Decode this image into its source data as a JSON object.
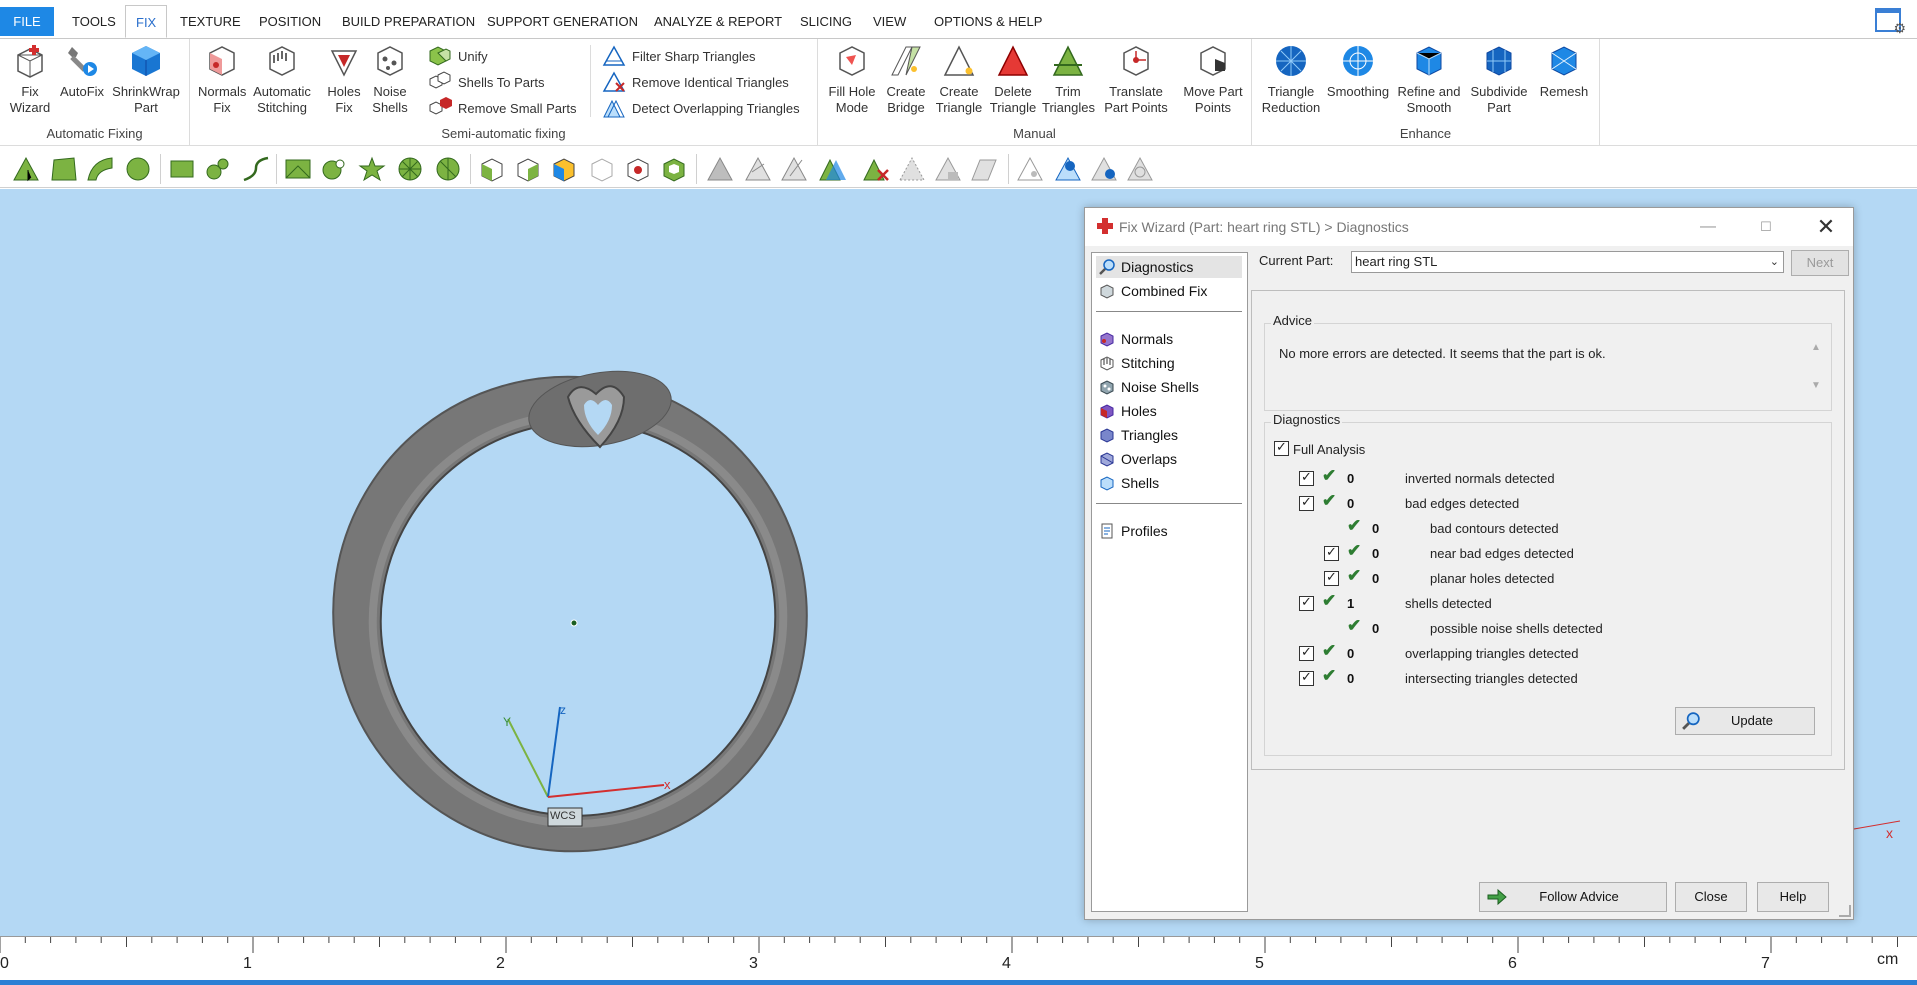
{
  "menu": {
    "file": "FILE",
    "tabs": [
      "TOOLS",
      "FIX",
      "TEXTURE",
      "POSITION",
      "BUILD PREPARATION",
      "SUPPORT GENERATION",
      "ANALYZE & REPORT",
      "SLICING",
      "VIEW",
      "OPTIONS & HELP"
    ],
    "active_tab": "FIX"
  },
  "ribbon": {
    "groups": {
      "automatic_fixing": "Automatic Fixing",
      "semi_automatic": "Semi-automatic fixing",
      "manual": "Manual",
      "enhance": "Enhance"
    },
    "automatic": {
      "fix_wizard": [
        "Fix",
        "Wizard"
      ],
      "autofix": [
        "AutoFix",
        ""
      ],
      "shrinkwrap": [
        "ShrinkWrap",
        "Part"
      ]
    },
    "semi": {
      "normals_fix": [
        "Normals",
        "Fix"
      ],
      "auto_stitching": [
        "Automatic",
        "Stitching"
      ],
      "holes_fix": [
        "Holes",
        "Fix"
      ],
      "noise_shells": [
        "Noise",
        "Shells"
      ],
      "unify": "Unify",
      "shells_to_parts": "Shells To Parts",
      "remove_small_parts": "Remove Small Parts",
      "filter_sharp": "Filter Sharp Triangles",
      "remove_identical": "Remove Identical Triangles",
      "detect_overlapping": "Detect Overlapping Triangles"
    },
    "manual": {
      "fill_hole_mode": [
        "Fill Hole",
        "Mode"
      ],
      "create_bridge": [
        "Create",
        "Bridge"
      ],
      "create_triangle": [
        "Create",
        "Triangle"
      ],
      "delete_triangle": [
        "Delete",
        "Triangle"
      ],
      "trim_triangles": [
        "Trim",
        "Triangles"
      ],
      "translate_points": [
        "Translate",
        "Part Points"
      ],
      "move_points": [
        "Move Part",
        "Points"
      ]
    },
    "enhance": {
      "triangle_reduction": [
        "Triangle",
        "Reduction"
      ],
      "smoothing": [
        "Smoothing",
        ""
      ],
      "refine_smooth": [
        "Refine and",
        "Smooth"
      ],
      "subdivide": [
        "Subdivide",
        "Part"
      ],
      "remesh": [
        "Remesh",
        ""
      ]
    }
  },
  "viewport": {
    "axis_labels": {
      "x": "x",
      "y": "Y",
      "z": "z"
    },
    "wcs_label": "WCS",
    "colors": {
      "background": "#b4d8f4",
      "ring": "#7a7a7a"
    }
  },
  "ruler": {
    "numbers": [
      "0",
      "1",
      "2",
      "3",
      "4",
      "5",
      "6",
      "7"
    ],
    "unit": "cm"
  },
  "dialog": {
    "title": "Fix Wizard (Part: heart ring STL) > Diagnostics",
    "nav": {
      "diagnostics": "Diagnostics",
      "combined_fix": "Combined Fix",
      "normals": "Normals",
      "stitching": "Stitching",
      "noise_shells": "Noise Shells",
      "holes": "Holes",
      "triangles": "Triangles",
      "overlaps": "Overlaps",
      "shells": "Shells",
      "profiles": "Profiles"
    },
    "current_part_label": "Current Part:",
    "current_part_value": "heart ring STL",
    "next_label": "Next",
    "advice_legend": "Advice",
    "advice_text": "No more errors are detected. It seems that the part is ok.",
    "diagnostics_legend": "Diagnostics",
    "full_analysis_label": "Full Analysis",
    "rows": {
      "inverted_normals": {
        "count": "0",
        "label": "inverted normals detected"
      },
      "bad_edges": {
        "count": "0",
        "label": "bad edges detected"
      },
      "bad_contours": {
        "count": "0",
        "label": "bad contours detected"
      },
      "near_bad_edges": {
        "count": "0",
        "label": "near bad edges detected"
      },
      "planar_holes": {
        "count": "0",
        "label": "planar holes detected"
      },
      "shells": {
        "count": "1",
        "label": "shells detected"
      },
      "noise_shells": {
        "count": "0",
        "label": "possible noise shells detected"
      },
      "overlapping": {
        "count": "0",
        "label": "overlapping triangles detected"
      },
      "intersecting": {
        "count": "0",
        "label": "intersecting triangles detected"
      }
    },
    "update_label": "Update",
    "follow_advice_label": "Follow Advice",
    "close_label": "Close",
    "help_label": "Help"
  }
}
